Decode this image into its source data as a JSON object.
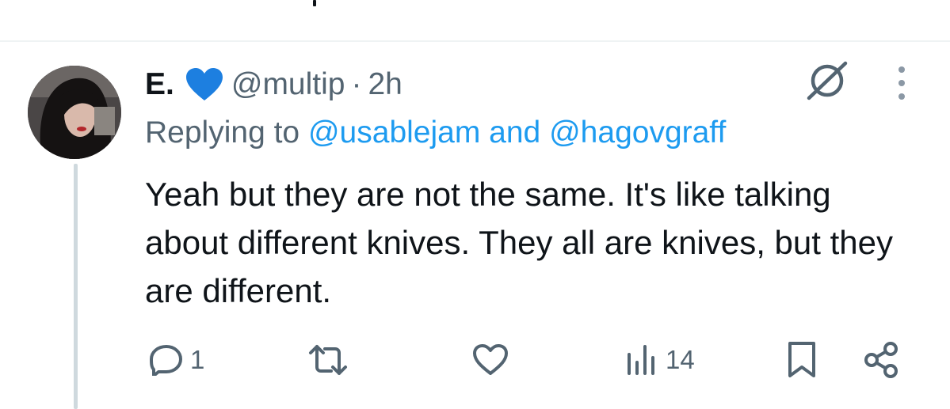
{
  "tweet": {
    "author_name": "E.",
    "author_badge_icon": "blue-heart-icon",
    "handle": "@multip",
    "separator": "·",
    "time": "2h",
    "replying_prefix": "Replying to",
    "reply_to_1": "@usablejam",
    "reply_joiner": "and",
    "reply_to_2": "@hagovgraff",
    "text": "Yeah but they are not the same. It's like talking about different knives. They all are knives, but they are different."
  },
  "actions": {
    "reply_count": "1",
    "repost_count": "",
    "like_count": "",
    "views_count": "14"
  },
  "icons": {
    "reply": "reply-icon",
    "repost": "repost-icon",
    "like": "like-icon",
    "views": "views-icon",
    "bookmark": "bookmark-icon",
    "share": "share-icon",
    "grok": "grok-icon",
    "more": "more-icon"
  },
  "colors": {
    "text": "#0f1419",
    "secondary": "#536471",
    "link": "#1d9bf0",
    "heart": "#1d7fe0",
    "thread_line": "#cfd9de"
  }
}
